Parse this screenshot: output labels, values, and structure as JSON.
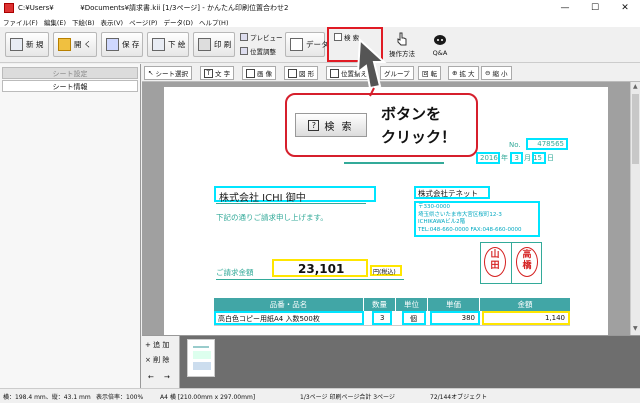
{
  "window": {
    "path": "C:¥Users¥",
    "title": "¥Documents¥請求書.kii  [1/3ページ] - かんたん印刷位置合わせ2",
    "min": "—",
    "max": "☐",
    "close": "✕"
  },
  "menu": [
    "ファイル(F)",
    "編集(E)",
    "下絵(B)",
    "表示(V)",
    "ページ(P)",
    "データ(D)",
    "ヘルプ(H)"
  ],
  "toolbar": {
    "new": "新 規",
    "open": "開 く",
    "save": "保 存",
    "underlay": "下 絵",
    "print": "印 刷",
    "preview": "プレビュー",
    "position": "位置調整",
    "data": "データ",
    "search": "検 索",
    "howto": "操作方法",
    "qa": "Q&A"
  },
  "left_panel": {
    "tab_settings": "シート設定",
    "tab_info": "シート情報"
  },
  "sub_toolbar": {
    "select": "シート選択",
    "text": "文 字",
    "image": "画 像",
    "shape": "図 形",
    "align": "位置揃え",
    "group": "グループ",
    "rotate": "回 転",
    "zoom_in": "拡 大",
    "zoom_out": "縮 小"
  },
  "invoice": {
    "no_label": "No.",
    "no_value": "478565",
    "year": "2016",
    "month": "3",
    "day": "15",
    "year_unit": "年",
    "month_unit": "月",
    "day_unit": "日",
    "company_to": "株式会社 ICHI  御中",
    "intro": "下記の通りご請求申し上げます。",
    "issuer_name": "株式会社テネット",
    "issuer_zip": "〒330-0000",
    "issuer_addr1": "埼玉県さいたま市大宮区桜町12-3",
    "issuer_addr2": "ICHIKAWAビル2階",
    "issuer_tel": "TEL:048-660-0000  FAX:048-660-0000",
    "amount_label": "ご請求金額",
    "amount_value": "23,101",
    "amount_suffix": "円(税込)",
    "stamp1": "山田",
    "stamp2": "高橋",
    "table_headers": [
      "品番・品名",
      "数量",
      "単位",
      "単価",
      "金額"
    ],
    "row1": [
      "高白色コピー用紙A4 入数500枚",
      "3",
      "個",
      "380",
      "1,140"
    ]
  },
  "callout": {
    "button_label": "検 索",
    "message_line1": "ボタンを",
    "message_line2": "クリック！"
  },
  "bottom_panel": {
    "add": "追 加",
    "delete": "削 除",
    "prev": "←",
    "next": "→"
  },
  "status": {
    "size": "横：198.4 mm、縦：43.1 mm",
    "zoom": "表示倍率：100%",
    "paper": "A4 横 [210.00mm x 297.00mm]",
    "pages": "1/3ページ  印刷ページ合計 3ページ",
    "objects": "72/144オブジェクト"
  },
  "colors": {
    "accent_red": "#e01b24",
    "highlight_cyan": "#00e5ff",
    "highlight_yellow": "#ffe600",
    "table_header": "#41a6a6"
  }
}
